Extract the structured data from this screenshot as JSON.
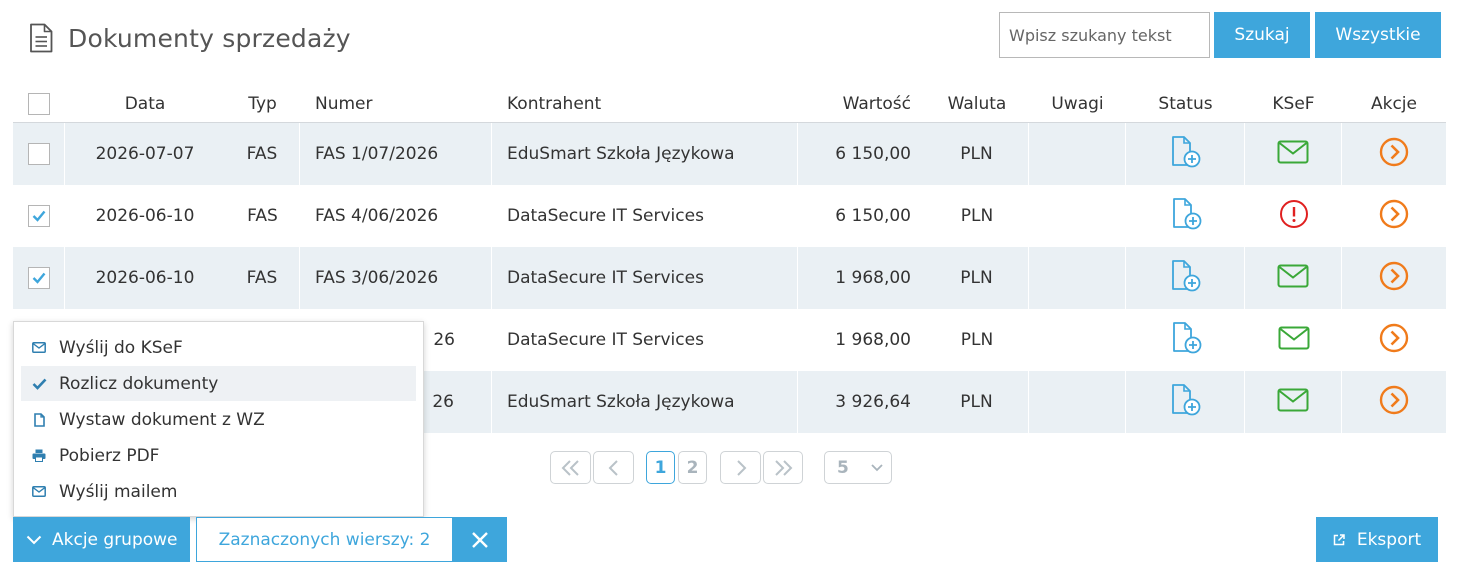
{
  "header": {
    "title": "Dokumenty sprzedaży",
    "search_placeholder": "Wpisz szukany tekst",
    "search_button": "Szukaj",
    "all_button": "Wszystkie"
  },
  "table": {
    "columns": [
      "Data",
      "Typ",
      "Numer",
      "Kontrahent",
      "Wartość",
      "Waluta",
      "Uwagi",
      "Status",
      "KSeF",
      "Akcje"
    ],
    "rows": [
      {
        "date": "2026-07-07",
        "type": "FAS",
        "number": "FAS 1/07/2026",
        "client": "EduSmart Szkoła Językowa",
        "value": "6 150,00",
        "currency": "PLN",
        "notes": "",
        "checked": false,
        "ksef": "envelope"
      },
      {
        "date": "2026-06-10",
        "type": "FAS",
        "number": "FAS 4/06/2026",
        "client": "DataSecure IT Services",
        "value": "6 150,00",
        "currency": "PLN",
        "notes": "",
        "checked": true,
        "ksef": "error"
      },
      {
        "date": "2026-06-10",
        "type": "FAS",
        "number": "FAS 3/06/2026",
        "client": "DataSecure IT Services",
        "value": "1 968,00",
        "currency": "PLN",
        "notes": "",
        "checked": true,
        "ksef": "envelope"
      },
      {
        "date": "",
        "type": "",
        "number": "26",
        "client": "DataSecure IT Services",
        "value": "1 968,00",
        "currency": "PLN",
        "notes": "",
        "checked": false,
        "ksef": "envelope"
      },
      {
        "date": "",
        "type": "",
        "number": "26",
        "client": "EduSmart Szkoła Językowa",
        "value": "3 926,64",
        "currency": "PLN",
        "notes": "",
        "checked": false,
        "ksef": "envelope"
      }
    ]
  },
  "group_menu": {
    "items": [
      {
        "label": "Wyślij do KSeF",
        "icon": "envelope-icon"
      },
      {
        "label": "Rozlicz dokumenty",
        "icon": "checkmark-icon"
      },
      {
        "label": "Wystaw dokument z WZ",
        "icon": "document-icon"
      },
      {
        "label": "Pobierz PDF",
        "icon": "printer-icon"
      },
      {
        "label": "Wyślij mailem",
        "icon": "envelope-icon"
      }
    ]
  },
  "pagination": {
    "pages": [
      "1",
      "2"
    ],
    "current": "1",
    "page_size": "5"
  },
  "footer": {
    "group_actions": "Akcje grupowe",
    "selected_rows": "Zaznaczonych wierszy: 2",
    "export": "Eksport"
  },
  "colors": {
    "accent": "#3ea6dc",
    "ksef_ok": "#3aa838",
    "ksef_error": "#e02020",
    "action": "#f07b1b",
    "row_stripe": "#eaf0f4"
  }
}
